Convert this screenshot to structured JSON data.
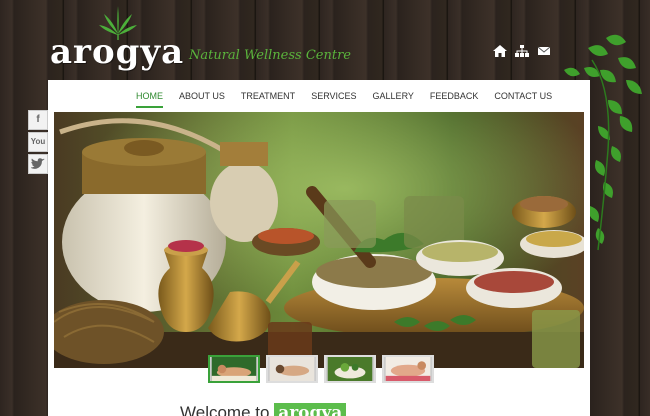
{
  "logo": {
    "text": "arogya",
    "tagline": "Natural Wellness Centre"
  },
  "top_icons": [
    "home-icon",
    "sitemap-icon",
    "mail-icon"
  ],
  "nav": {
    "items": [
      {
        "label": "HOME",
        "active": true
      },
      {
        "label": "ABOUT US",
        "active": false
      },
      {
        "label": "TREATMENT",
        "active": false
      },
      {
        "label": "SERVICES",
        "active": false
      },
      {
        "label": "GALLERY",
        "active": false
      },
      {
        "label": "FEEDBACK",
        "active": false
      },
      {
        "label": "CONTACT US",
        "active": false
      }
    ]
  },
  "social": [
    {
      "label": "f",
      "icon": "facebook-icon"
    },
    {
      "label": "You",
      "icon": "youtube-icon"
    },
    {
      "label": "",
      "icon": "twitter-icon"
    }
  ],
  "thumbnails": [
    {
      "icon": "massage-thumbnail",
      "active": true
    },
    {
      "icon": "spa-thumbnail",
      "active": false
    },
    {
      "icon": "herbs-thumbnail",
      "active": false
    },
    {
      "icon": "therapy-thumbnail",
      "active": false
    }
  ],
  "welcome": {
    "prefix": "Welcome to",
    "brand": "arogya"
  },
  "colors": {
    "accent_green": "#3aa23a",
    "tagline_green": "#5ab43c",
    "wood": "#33291f"
  }
}
